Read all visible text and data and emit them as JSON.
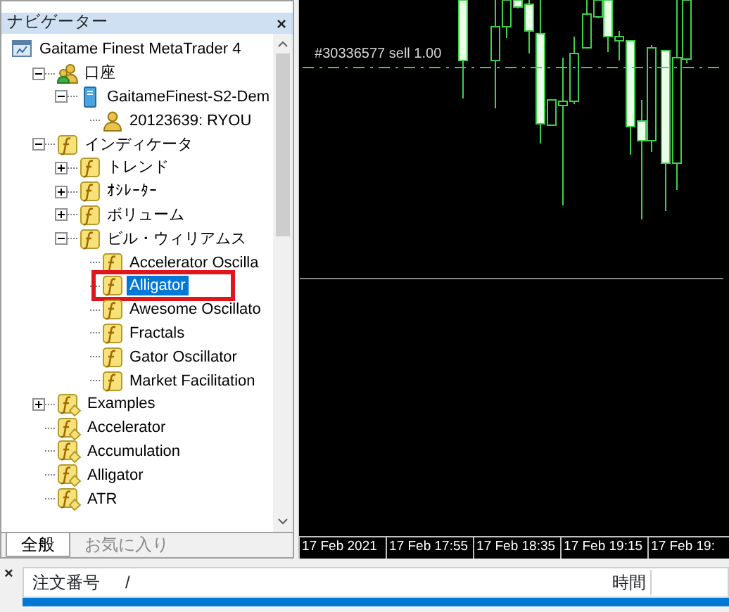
{
  "navigator": {
    "title": "ナビゲーター",
    "close": "×",
    "tree": [
      {
        "label": "Gaitame Finest MetaTrader 4",
        "kind": "terminal",
        "selected": false,
        "children": [
          {
            "label": "口座",
            "kind": "accounts",
            "selected": false,
            "expanded": true,
            "children": [
              {
                "label": "GaitameFinest-S2-Dem",
                "kind": "server",
                "selected": false,
                "expanded": true,
                "children": [
                  {
                    "label": "20123639: RYOU",
                    "kind": "user",
                    "selected": false
                  }
                ]
              }
            ]
          },
          {
            "label": "インディケータ",
            "kind": "folder",
            "selected": false,
            "expanded": true,
            "children": [
              {
                "label": "トレンド",
                "kind": "folder",
                "selected": false,
                "expanded": false
              },
              {
                "label": "ｵｼﾚｰﾀｰ",
                "kind": "folder",
                "selected": false,
                "expanded": false
              },
              {
                "label": "ボリューム",
                "kind": "folder",
                "selected": false,
                "expanded": false
              },
              {
                "label": "ビル・ウィリアムス",
                "kind": "folder",
                "selected": false,
                "expanded": true,
                "children": [
                  {
                    "label": "Accelerator Oscilla",
                    "kind": "indicator",
                    "selected": false,
                    "boxed": false
                  },
                  {
                    "label": "Alligator",
                    "kind": "indicator",
                    "selected": true,
                    "boxed": true
                  },
                  {
                    "label": "Awesome Oscillato",
                    "kind": "indicator",
                    "selected": false,
                    "boxed": false
                  },
                  {
                    "label": "Fractals",
                    "kind": "indicator",
                    "selected": false,
                    "boxed": false
                  },
                  {
                    "label": "Gator Oscillator",
                    "kind": "indicator",
                    "selected": false,
                    "boxed": false
                  },
                  {
                    "label": "Market Facilitation",
                    "kind": "indicator",
                    "selected": false,
                    "boxed": false
                  }
                ]
              }
            ]
          },
          {
            "label": "Examples",
            "kind": "custom",
            "selected": false,
            "expanded": false
          },
          {
            "label": "Accelerator",
            "kind": "custom",
            "selected": false
          },
          {
            "label": "Accumulation",
            "kind": "custom",
            "selected": false
          },
          {
            "label": "Alligator",
            "kind": "custom",
            "selected": false
          },
          {
            "label": "ATR",
            "kind": "custom",
            "selected": false
          }
        ]
      }
    ],
    "tabs": [
      {
        "label": "全般",
        "selected": true
      },
      {
        "label": "お気に入り",
        "selected": false
      }
    ]
  },
  "chart": {
    "order_label": "#30336577 sell 1.00",
    "time_labels": [
      "17 Feb 2021",
      "17 Feb 17:55",
      "17 Feb 18:35",
      "17 Feb 19:15",
      "17 Feb 19:"
    ]
  },
  "terminal": {
    "close": "×",
    "columns": [
      {
        "label": "注文番号",
        "sort_mark": "/"
      },
      {
        "label": "時間"
      }
    ],
    "rows": [
      {
        "selected": true
      }
    ]
  }
}
